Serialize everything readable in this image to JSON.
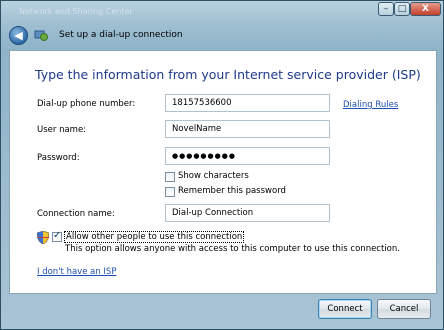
{
  "window": {
    "background_text": "Network and Sharing Center",
    "controls": {
      "minimize": "–",
      "maximize": "□",
      "close": "X"
    }
  },
  "nav": {
    "title": "Set up a dial-up connection"
  },
  "main": {
    "heading": "Type the information from your Internet service provider (ISP)",
    "phone": {
      "label": "Dial-up phone number:",
      "value": "18157536600"
    },
    "dialing_rules": "Dialing Rules",
    "username": {
      "label": "User name:",
      "value": "NovelName"
    },
    "password": {
      "label": "Password:",
      "value": "●●●●●●●●●"
    },
    "show_characters": {
      "label": "Show characters",
      "checked": false
    },
    "remember_password": {
      "label": "Remember this password",
      "checked": false
    },
    "connection_name": {
      "label": "Connection name:",
      "value": "Dial-up Connection"
    },
    "allow_others": {
      "label": "Allow other people to use this connection",
      "description": "This option allows anyone with access to this computer to use this connection.",
      "checked": true
    },
    "no_isp_link": "I don't have an ISP"
  },
  "footer": {
    "connect_label": "Connect",
    "cancel_label": "Cancel"
  },
  "colors": {
    "heading": "#1e3a8a",
    "link": "#1f4fb5",
    "frame": "#9fbfd1"
  }
}
